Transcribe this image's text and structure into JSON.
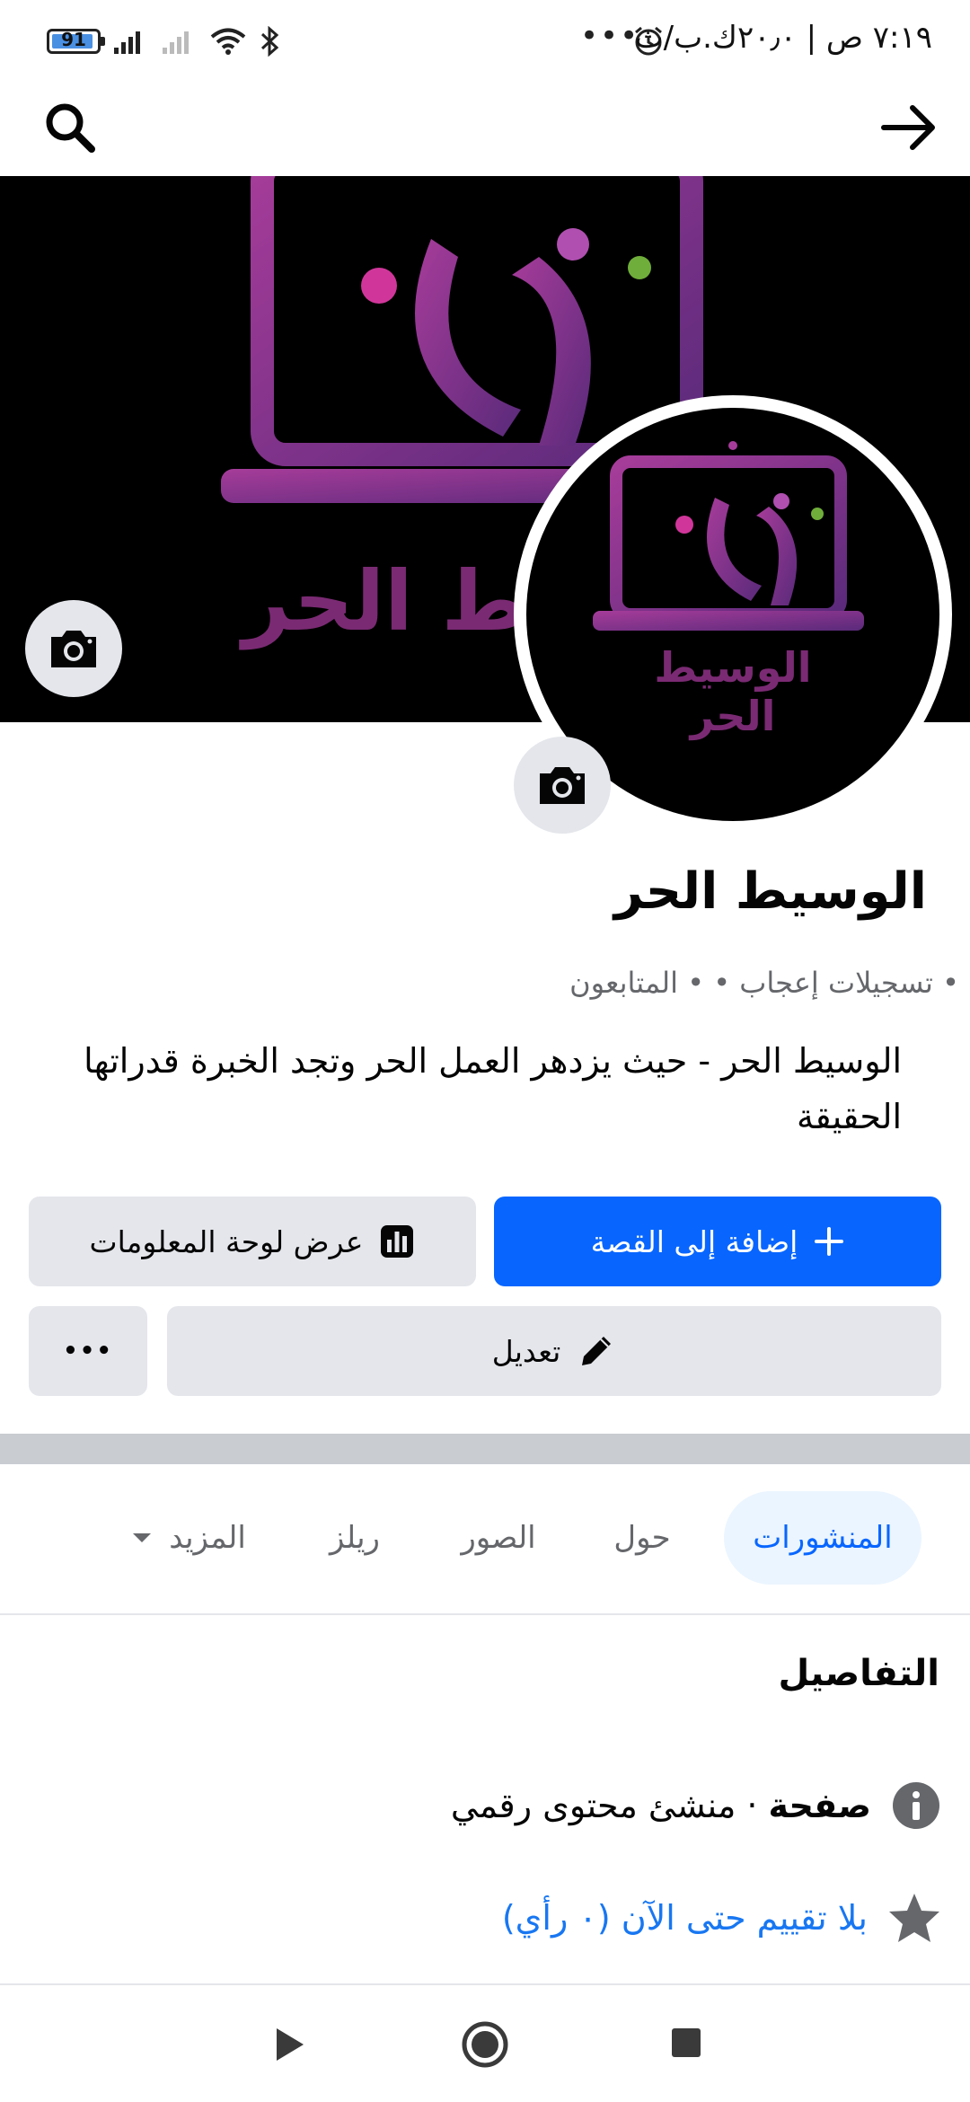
{
  "status_bar": {
    "time": "٧:١٩ ص | ٢٠٫٠ك.ب/ث",
    "battery": "91",
    "more_dots": "•••"
  },
  "page": {
    "name": "الوسيط الحر",
    "stats": "• تسجيلات إعجاب  •  • المتابعون",
    "bio": "الوسيط الحر - حيث يزدهر العمل الحر وتجد الخبرة قدراتها الحقيقة",
    "logo_text": "الوسيط الحر"
  },
  "buttons": {
    "add_story": "إضافة إلى القصة",
    "dashboard": "عرض لوحة المعلومات",
    "edit": "تعديل",
    "more": "•••"
  },
  "tabs": [
    {
      "label": "المنشورات",
      "active": true
    },
    {
      "label": "حول",
      "active": false
    },
    {
      "label": "الصور",
      "active": false
    },
    {
      "label": "ريلز",
      "active": false
    },
    {
      "label": "المزيد",
      "active": false
    }
  ],
  "details": {
    "title": "التفاصيل",
    "category_bold": "صفحة",
    "category_rest": "· منشئ محتوى رقمي",
    "rating": "بلا تقييم حتى الآن (٠ رأي)"
  },
  "colors": {
    "accent": "#0866ff",
    "logo_purple": "#7a2a73",
    "tab_active_bg": "#ebf5ff",
    "button_grey": "#e4e6eb"
  }
}
